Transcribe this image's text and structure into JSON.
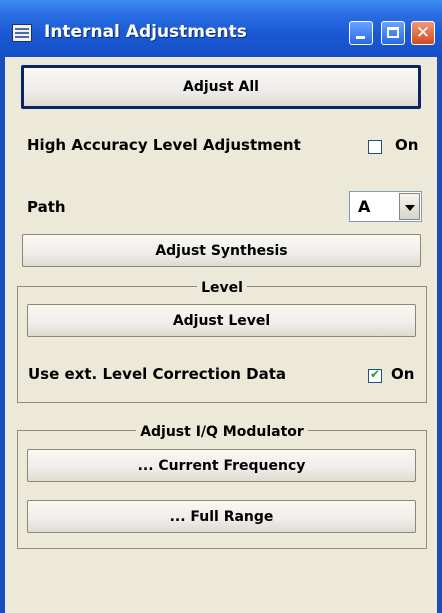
{
  "window": {
    "title": "Internal Adjustments"
  },
  "buttons": {
    "adjust_all": "Adjust All",
    "adjust_synthesis": "Adjust Synthesis",
    "adjust_level": "Adjust Level",
    "current_frequency": "... Current Frequency",
    "full_range": "... Full Range"
  },
  "high_accuracy": {
    "label": "High Accuracy Level Adjustment",
    "checkbox_label": "On",
    "checked": false
  },
  "path": {
    "label": "Path",
    "selected": "A"
  },
  "level_group": {
    "title": "Level",
    "ext_correction": {
      "label": "Use ext. Level Correction Data",
      "checkbox_label": "On",
      "checked": true
    }
  },
  "iq_group": {
    "title": "Adjust I/Q Modulator"
  }
}
